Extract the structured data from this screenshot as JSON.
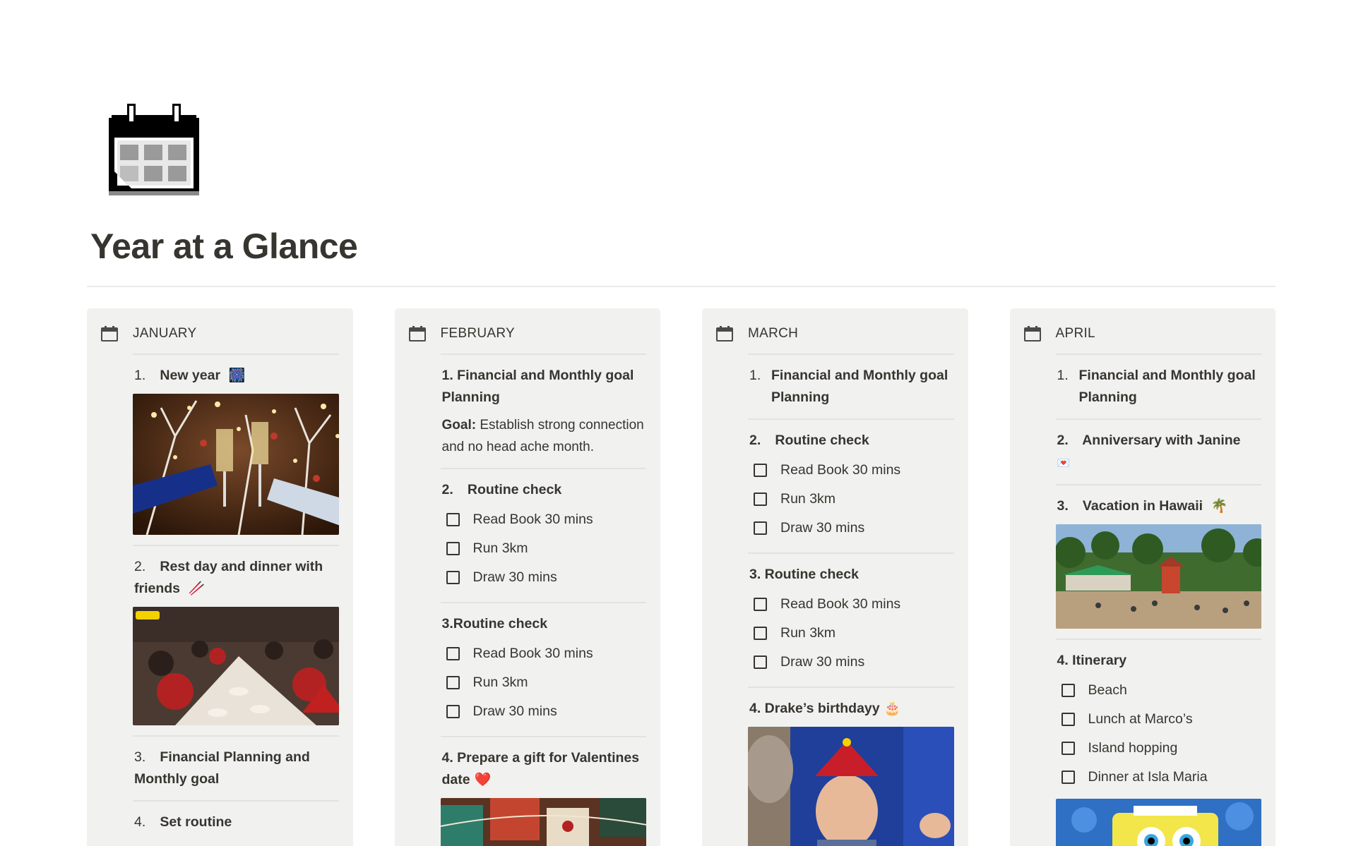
{
  "page": {
    "icon": "calendar-icon",
    "title": "Year at a Glance"
  },
  "colors": {
    "text": "#37352f",
    "column_bg": "#f1f1ef",
    "divider": "#e2e2df"
  },
  "columns": [
    {
      "title": "JANUARY",
      "blocks": [
        {
          "num": "1.",
          "title": "New year",
          "emoji": "🎆",
          "image": "champagne-toast-image"
        },
        {
          "num": "2.",
          "title": "Rest day and dinner with friends",
          "emoji": "🥢",
          "image": "holiday-dinner-image"
        },
        {
          "num": "3.",
          "title": "Financial Planning and Monthly goal"
        },
        {
          "num": "4.",
          "title": "Set routine"
        }
      ]
    },
    {
      "title": "FEBRUARY",
      "blocks": [
        {
          "title": "1. Financial and Monthly goal Planning",
          "goal_label": "Goal:",
          "goal_text": "Establish strong connection and no head ache month."
        },
        {
          "num": "2.",
          "title": "Routine check",
          "todos": [
            "Read Book 30 mins",
            "Run 3km",
            "Draw 30 mins"
          ]
        },
        {
          "title": "3.Routine check",
          "todos": [
            "Read Book 30 mins",
            "Run 3km",
            "Draw 30 mins"
          ]
        },
        {
          "title": "4. Prepare a gift for Valentines date",
          "emoji": "❤️",
          "image": "gift-wrapping-image"
        }
      ]
    },
    {
      "title": "MARCH",
      "blocks": [
        {
          "num": "1.",
          "title": "Financial and Monthly goal Planning"
        },
        {
          "num": "2.",
          "title": "Routine check",
          "todos": [
            "Read Book 30 mins",
            "Run 3km",
            "Draw 30 mins"
          ]
        },
        {
          "title": "3. Routine check",
          "todos": [
            "Read Book 30 mins",
            "Run 3km",
            "Draw 30 mins"
          ]
        },
        {
          "title": "4. Drake’s birthdayy",
          "emoji": "🎂",
          "image": "birthday-party-image"
        }
      ]
    },
    {
      "title": "APRIL",
      "blocks": [
        {
          "num": "1.",
          "title": "Financial and Monthly goal Planning"
        },
        {
          "num": "2.",
          "title": "Anniversary with Janine",
          "emoji": "💌"
        },
        {
          "num": "3.",
          "title": "Vacation in Hawaii",
          "emoji": "🌴",
          "image": "hawaii-beach-image"
        },
        {
          "title": "4. Itinerary",
          "todos": [
            "Beach",
            "Lunch at Marco’s",
            "Island hopping",
            "Dinner at Isla Maria"
          ],
          "image": "spongebob-image"
        }
      ]
    }
  ]
}
